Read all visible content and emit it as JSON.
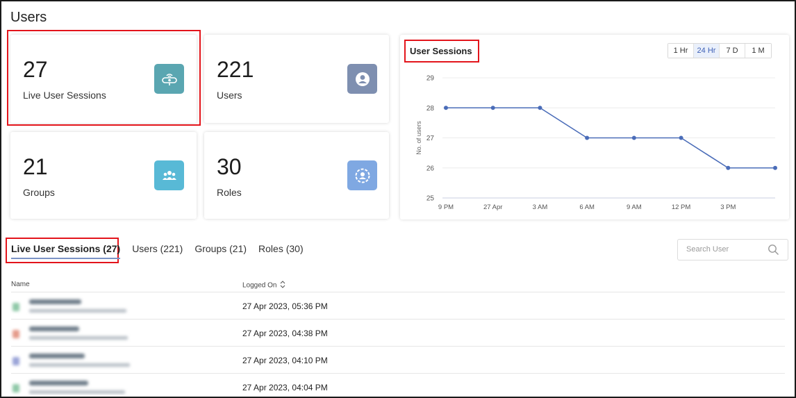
{
  "page_title": "Users",
  "stats": [
    {
      "value": "27",
      "label": "Live User Sessions",
      "icon": "broadcast-icon",
      "color": "#5aa6b1"
    },
    {
      "value": "221",
      "label": "Users",
      "icon": "user-icon",
      "color": "#7e8fb0"
    },
    {
      "value": "21",
      "label": "Groups",
      "icon": "group-icon",
      "color": "#58b9d6"
    },
    {
      "value": "30",
      "label": "Roles",
      "icon": "role-icon",
      "color": "#7fa8e2"
    }
  ],
  "chart": {
    "title": "User Sessions",
    "ranges": [
      "1 Hr",
      "24 Hr",
      "7 D",
      "1 M"
    ],
    "active_range": "24 Hr"
  },
  "chart_data": {
    "type": "line",
    "ylabel": "No. of users",
    "ylim": [
      25,
      29
    ],
    "y_ticks": [
      "25",
      "26",
      "27",
      "28",
      "29"
    ],
    "x_tick_labels": [
      "9 PM",
      "27 Apr",
      "3 AM",
      "6 AM",
      "9 AM",
      "12 PM",
      "3 PM"
    ],
    "series": [
      {
        "values": [
          28,
          28,
          28,
          27,
          27,
          27,
          26,
          26
        ]
      }
    ],
    "line_color": "#4a6cb8",
    "grid": true,
    "legend": "none"
  },
  "tabs": [
    {
      "label": "Live User Sessions (27)",
      "active": true
    },
    {
      "label": "Users (221)",
      "active": false
    },
    {
      "label": "Groups (21)",
      "active": false
    },
    {
      "label": "Roles (30)",
      "active": false
    }
  ],
  "search": {
    "placeholder": "Search User"
  },
  "table": {
    "columns": [
      "Name",
      "Logged On"
    ],
    "rows": [
      {
        "logged_on": "27 Apr 2023, 05:36 PM"
      },
      {
        "logged_on": "27 Apr 2023, 04:38 PM"
      },
      {
        "logged_on": "27 Apr 2023, 04:10 PM"
      },
      {
        "logged_on": "27 Apr 2023, 04:04 PM"
      }
    ]
  }
}
